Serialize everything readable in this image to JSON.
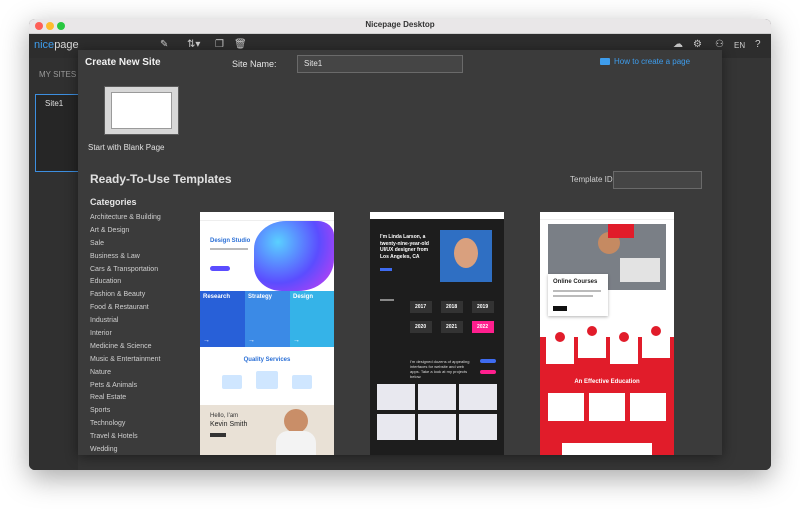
{
  "window": {
    "title": "Nicepage Desktop"
  },
  "toolbar": {
    "logo_prefix": "nice",
    "logo_suffix": "page",
    "language": "EN"
  },
  "sidebar": {
    "heading": "MY SITES",
    "site_name": "Site1"
  },
  "dialog": {
    "title": "Create New Site",
    "site_name_label": "Site Name:",
    "site_name_value": "Site1",
    "help_link": "How to create a page",
    "blank_page_label": "Start with Blank Page",
    "templates_heading": "Ready-To-Use Templates",
    "template_id_label": "Template ID",
    "categories_heading": "Categories",
    "categories": [
      "Architecture & Building",
      "Art & Design",
      "Sale",
      "Business & Law",
      "Cars & Transportation",
      "Education",
      "Fashion & Beauty",
      "Food & Restaurant",
      "Industrial",
      "Interior",
      "Medicine & Science",
      "Music & Entertainment",
      "Nature",
      "Pets & Animals",
      "Real Estate",
      "Sports",
      "Technology",
      "Travel & Hotels",
      "Wedding"
    ]
  },
  "templates": [
    {
      "hero_title": "Design Studio",
      "col1": "Research",
      "col2": "Strategy",
      "col3": "Design",
      "services_title": "Quality Services",
      "hello": "Hello, I'am",
      "name": "Kevin Smith"
    },
    {
      "hero_title": "I'm Linda Larson, a twenty-nine-year-old UI/UX designer from Los Angeles, CA",
      "years": [
        "2017",
        "2018",
        "2019",
        "2020",
        "2021",
        "2022"
      ],
      "intro": "I'm designed dozens of appealing interfaces for website and web apps. Take a look at my projects below."
    },
    {
      "hero_title": "Online Courses",
      "section_title": "An Effective Education"
    }
  ],
  "colors": {
    "accent": "#3e9ded",
    "pink": "#ff1f8e",
    "red": "#e11c2a"
  }
}
